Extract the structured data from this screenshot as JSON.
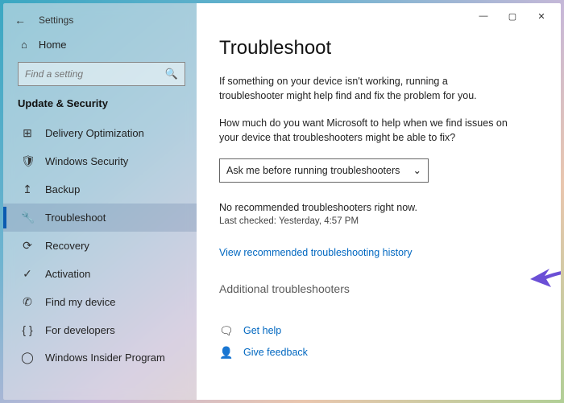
{
  "window": {
    "title": "Settings"
  },
  "sidebar": {
    "home_label": "Home",
    "search_placeholder": "Find a setting",
    "section_label": "Update & Security",
    "items": [
      {
        "label": "Delivery Optimization",
        "icon": "⊞"
      },
      {
        "label": "Windows Security",
        "icon": "🛡"
      },
      {
        "label": "Backup",
        "icon": "↥"
      },
      {
        "label": "Troubleshoot",
        "icon": "🔧",
        "active": true
      },
      {
        "label": "Recovery",
        "icon": "⟳"
      },
      {
        "label": "Activation",
        "icon": "✓"
      },
      {
        "label": "Find my device",
        "icon": "✆"
      },
      {
        "label": "For developers",
        "icon": "{ }"
      },
      {
        "label": "Windows Insider Program",
        "icon": "◯"
      }
    ]
  },
  "main": {
    "heading": "Troubleshoot",
    "intro": "If something on your device isn't working, running a troubleshooter might help find and fix the problem for you.",
    "question": "How much do you want Microsoft to help when we find issues on your device that troubleshooters might be able to fix?",
    "dropdown_value": "Ask me before running troubleshooters",
    "status_none": "No recommended troubleshooters right now.",
    "status_checked": "Last checked: Yesterday, 4:57 PM",
    "history_link": "View recommended troubleshooting history",
    "additional_heading": "Additional troubleshooters",
    "get_help": "Get help",
    "give_feedback": "Give feedback"
  },
  "annotation": {
    "arrow_color": "#6b4fd6"
  }
}
